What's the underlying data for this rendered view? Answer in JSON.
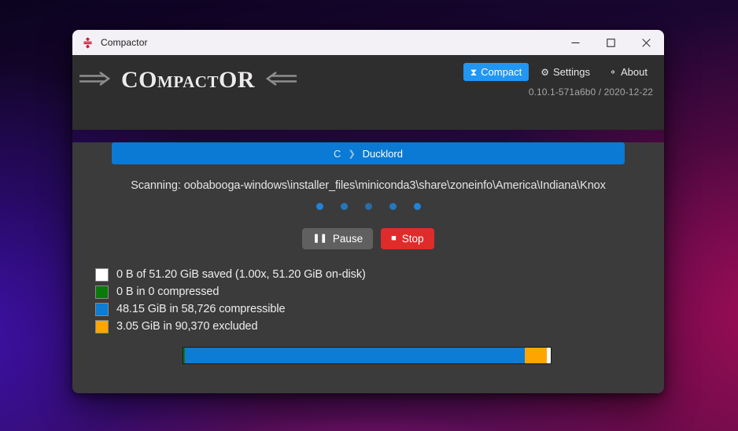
{
  "window": {
    "title": "Compactor",
    "icon": "compactor-icon",
    "controls": {
      "minimize": "—",
      "maximize": "☐",
      "close": "✕"
    }
  },
  "header": {
    "logo": {
      "arrow_left": "⟹",
      "arrow_right": "⟸",
      "letters": [
        {
          "ch": "C",
          "size": "big"
        },
        {
          "ch": "O",
          "size": "big"
        },
        {
          "ch": "M",
          "size": "small"
        },
        {
          "ch": "P",
          "size": "small"
        },
        {
          "ch": "A",
          "size": "small"
        },
        {
          "ch": "C",
          "size": "small"
        },
        {
          "ch": "T",
          "size": "small"
        },
        {
          "ch": "O",
          "size": "big"
        },
        {
          "ch": "R",
          "size": "big"
        }
      ]
    },
    "nav": [
      {
        "label": "Compact",
        "icon": "⧗",
        "icon_name": "hourglass-icon",
        "active": true
      },
      {
        "label": "Settings",
        "icon": "⚙",
        "icon_name": "gear-icon",
        "active": false
      },
      {
        "label": "About",
        "icon": "⚬",
        "icon_name": "info-icon",
        "active": false
      }
    ],
    "version": "0.10.1-571a6b0 / 2020-12-22"
  },
  "main": {
    "breadcrumb": {
      "drive": "C",
      "separator": "❯",
      "folder": "Ducklord"
    },
    "status_text": "Scanning: oobabooga-windows\\installer_files\\miniconda3\\share\\zoneinfo\\America\\Indiana\\Knox",
    "spinner_dots": 5,
    "buttons": {
      "pause": {
        "label": "Pause",
        "icon": "❚❚",
        "icon_name": "pause-icon"
      },
      "stop": {
        "label": "Stop",
        "icon": "■",
        "icon_name": "stop-icon"
      }
    },
    "legend": [
      {
        "color": "#ffffff",
        "label": "0 B of 51.20 GiB saved (1.00x, 51.20 GiB on-disk)",
        "name": "saved"
      },
      {
        "color": "#0a7a0a",
        "label": "0 B in 0 compressed",
        "name": "compressed"
      },
      {
        "color": "#0c7cd5",
        "label": "48.15 GiB in 58,726 compressible",
        "name": "compressible"
      },
      {
        "color": "#ffa500",
        "label": "3.05 GiB in 90,370 excluded",
        "name": "excluded"
      }
    ],
    "progress": {
      "segments": [
        {
          "color": "#0a7a0a",
          "percent": 0.5,
          "name": "compressed"
        },
        {
          "color": "#0c7cd5",
          "percent": 92.5,
          "name": "compressible"
        },
        {
          "color": "#ffa500",
          "percent": 6.0,
          "name": "excluded"
        },
        {
          "color": "#ffffff",
          "percent": 1.0,
          "name": "remaining"
        }
      ]
    }
  },
  "colors": {
    "accent": "#2196f3",
    "breadcrumb": "#0a7ad4",
    "stop": "#e02b2b",
    "pause": "#606060",
    "window_bg": "#3b3b3b",
    "header_bg": "#2e2e2e"
  }
}
